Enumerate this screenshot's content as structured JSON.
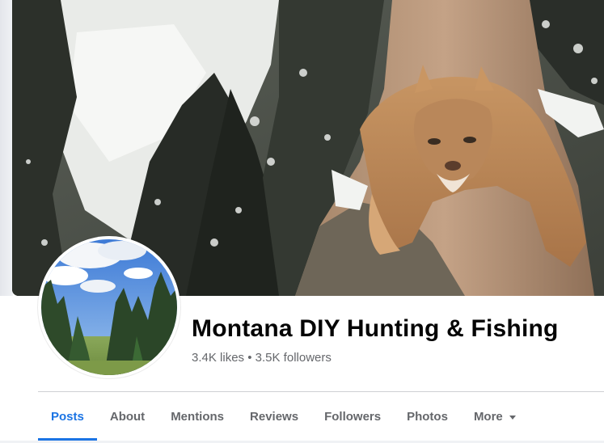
{
  "page": {
    "name": "Montana DIY Hunting & Fishing",
    "likes": "3.4K likes",
    "separator": "•",
    "followers": "3.5K followers"
  },
  "cover_photo": {
    "subject": "mountain lion on snowy tree trunk"
  },
  "profile_photo": {
    "subject": "forest meadow under cloudy blue sky"
  },
  "tabs": [
    {
      "label": "Posts",
      "active": true
    },
    {
      "label": "About",
      "active": false
    },
    {
      "label": "Mentions",
      "active": false
    },
    {
      "label": "Reviews",
      "active": false
    },
    {
      "label": "Followers",
      "active": false
    },
    {
      "label": "Photos",
      "active": false
    },
    {
      "label": "More",
      "active": false
    }
  ],
  "colors": {
    "accent": "#1b74e4",
    "text_primary": "#050505",
    "text_secondary": "#65676b",
    "divider": "#ced0d4"
  },
  "icons": {
    "more_dropdown": "caret-down-icon"
  }
}
